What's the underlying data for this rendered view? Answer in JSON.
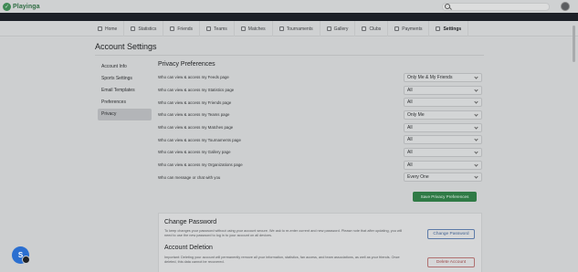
{
  "app": {
    "logo_text": "Playinga"
  },
  "nav": {
    "items": [
      {
        "label": "Home",
        "icon": "home-icon"
      },
      {
        "label": "Statistics",
        "icon": "chart-icon"
      },
      {
        "label": "Friends",
        "icon": "friends-icon"
      },
      {
        "label": "Teams",
        "icon": "teams-icon"
      },
      {
        "label": "Matches",
        "icon": "matches-icon"
      },
      {
        "label": "Tournaments",
        "icon": "trophy-icon"
      },
      {
        "label": "Gallery",
        "icon": "gallery-icon"
      },
      {
        "label": "Clubs",
        "icon": "clubs-icon"
      },
      {
        "label": "Payments",
        "icon": "payments-icon"
      },
      {
        "label": "Settings",
        "icon": "gear-icon"
      }
    ],
    "active": "Settings"
  },
  "page": {
    "title": "Account Settings"
  },
  "sidebar": {
    "items": [
      {
        "label": "Account Info"
      },
      {
        "label": "Sports Settings"
      },
      {
        "label": "Email Templates"
      },
      {
        "label": "Preferences"
      },
      {
        "label": "Privacy"
      }
    ],
    "active": "Privacy"
  },
  "privacy": {
    "title": "Privacy Preferences",
    "rows": [
      {
        "label": "Who can view & access my Feeds page",
        "value": "Only Me & My Friends"
      },
      {
        "label": "Who can view & access my Statistics page",
        "value": "All"
      },
      {
        "label": "Who can view & access my Friends page",
        "value": "All"
      },
      {
        "label": "Who can view & access my Teams page",
        "value": "Only Me"
      },
      {
        "label": "Who can view & access my Matches page",
        "value": "All"
      },
      {
        "label": "Who can view & access my Tournaments page",
        "value": "All"
      },
      {
        "label": "Who can view & access my Gallery page",
        "value": "All"
      },
      {
        "label": "Who can view & access my Organizations page",
        "value": "All"
      },
      {
        "label": "Who can message or chat with you",
        "value": "Every One"
      }
    ],
    "save_label": "Save Privacy Preferences"
  },
  "change_password": {
    "title": "Change Password",
    "description": "To keep changes your password without using your account secure. We ask to re-enter current and new password. Please note that after updating, you will need to use the new password to log in to your account on all devices.",
    "button_label": "Change Password"
  },
  "account_deletion": {
    "title": "Account Deletion",
    "description": "Important: Deleting your account will permanently remove all your information, statistics, fan access, and team associations, as well as your friends. Once deleted, this data cannot be recovered.",
    "button_label": "Delete Account"
  }
}
